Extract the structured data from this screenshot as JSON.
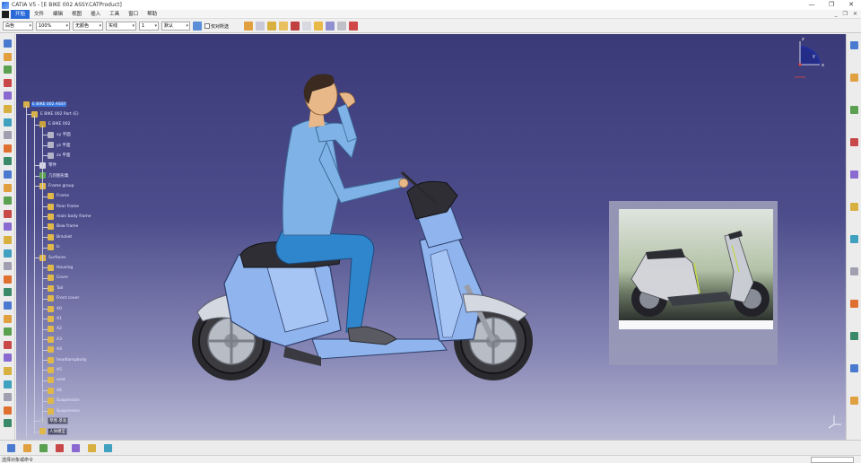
{
  "window": {
    "title": "CATIA V5 - [E BIKE 002 ASSY.CATProduct]",
    "buttons": [
      "—",
      "❐",
      "✕"
    ]
  },
  "menubar": {
    "items": [
      "开始",
      "文件",
      "编辑",
      "视图",
      "插入",
      "工具",
      "窗口",
      "帮助"
    ],
    "active_index": 0,
    "right_buttons": [
      "_",
      "❐",
      "✕"
    ]
  },
  "properties_toolbar": {
    "combos": [
      {
        "value": "白色"
      },
      {
        "value": "100%"
      },
      {
        "value": "无颜色"
      },
      {
        "value": "实线"
      },
      {
        "value": "1"
      },
      {
        "value": "默认"
      }
    ],
    "checkbox_label": "仅对所选"
  },
  "spec_tree": {
    "nodes": [
      {
        "label": "E BIKE 002 ASSY",
        "depth": 0,
        "selected": true,
        "icon_color": "#d7b24a"
      },
      {
        "label": "E BIKE 002 Part (E)",
        "depth": 1,
        "icon_color": "#d7b24a"
      },
      {
        "label": "E BIKE 002",
        "depth": 2,
        "icon_color": "#c9a33a"
      },
      {
        "label": "xy 平面",
        "depth": 3,
        "icon_color": "#b4b4c8"
      },
      {
        "label": "yz 平面",
        "depth": 3,
        "icon_color": "#b4b4c8"
      },
      {
        "label": "zx 平面",
        "depth": 3,
        "icon_color": "#b4b4c8"
      },
      {
        "label": "零件",
        "depth": 2,
        "icon_color": "#d4d4e4"
      },
      {
        "label": "几何图形集",
        "depth": 2,
        "icon_color": "#5fa64f"
      },
      {
        "label": "Frame group",
        "depth": 2,
        "icon_color": "#e0b84a"
      },
      {
        "label": "Frame",
        "depth": 3,
        "icon_color": "#e0b84a"
      },
      {
        "label": "Rear frame",
        "depth": 3,
        "icon_color": "#e0b84a"
      },
      {
        "label": "main body frame",
        "depth": 3,
        "icon_color": "#e0b84a"
      },
      {
        "label": "Bow frame",
        "depth": 3,
        "icon_color": "#e0b84a"
      },
      {
        "label": "Bracket",
        "depth": 3,
        "icon_color": "#e0b84a"
      },
      {
        "label": "Ic",
        "depth": 3,
        "icon_color": "#e0b84a"
      },
      {
        "label": "Surfaces",
        "depth": 2,
        "icon_color": "#e0b84a"
      },
      {
        "label": "Housing",
        "depth": 3,
        "icon_color": "#e0b84a"
      },
      {
        "label": "Cover",
        "depth": 3,
        "icon_color": "#e0b84a"
      },
      {
        "label": "Tail",
        "depth": 3,
        "icon_color": "#e0b84a"
      },
      {
        "label": "Front cover",
        "depth": 3,
        "icon_color": "#e0b84a"
      },
      {
        "label": "A0",
        "depth": 3,
        "icon_color": "#e0b84a"
      },
      {
        "label": "A1",
        "depth": 3,
        "icon_color": "#e0b84a"
      },
      {
        "label": "A2",
        "depth": 3,
        "icon_color": "#e0b84a"
      },
      {
        "label": "A3",
        "depth": 3,
        "icon_color": "#e0b84a"
      },
      {
        "label": "A4",
        "depth": 3,
        "icon_color": "#e0b84a"
      },
      {
        "label": "headlampbody",
        "depth": 3,
        "icon_color": "#e0b84a"
      },
      {
        "label": "A5",
        "depth": 3,
        "icon_color": "#e0b84a"
      },
      {
        "label": "seat",
        "depth": 3,
        "icon_color": "#e0b84a"
      },
      {
        "label": "A6",
        "depth": 3,
        "icon_color": "#e0b84a"
      },
      {
        "label": "Suspension",
        "depth": 3,
        "icon_color": "#e0b84a"
      },
      {
        "label": "Suspension",
        "depth": 3,
        "icon_color": "#e0b84a"
      },
      {
        "label": "草图.基准",
        "depth": 2,
        "boxed": true,
        "icon_color": "#b4b4c8"
      },
      {
        "label": "人体模型",
        "depth": 2,
        "boxed": true,
        "icon_color": "#e0b84a"
      }
    ]
  },
  "compass": {
    "x_label": "x",
    "y_label": "y",
    "z_label": "z"
  },
  "statusbar": {
    "text": "选择对象或命令"
  },
  "colors": {
    "viewport_top": "#3a3a78",
    "viewport_bottom": "#b8b8d4",
    "selection": "#3b78e0",
    "scooter_body": "#8fb4ee",
    "rider_shirt": "#7fb2e6",
    "rider_pants": "#2f86cc"
  },
  "icons": {
    "left_toolbar": [
      "sketch-icon",
      "point-icon",
      "line-icon",
      "plane-icon",
      "extrude-icon",
      "revolve-icon",
      "sweep-icon",
      "fill-icon",
      "join-icon",
      "trim-icon",
      "split-icon",
      "boundary-icon",
      "extract-icon",
      "fillet-icon",
      "translate-icon",
      "rotate-icon",
      "symmetry-icon",
      "scale-icon",
      "pattern-icon",
      "measure-icon",
      "analysis-icon",
      "render-icon",
      "material-icon",
      "scene-icon",
      "light-icon",
      "camera-icon",
      "turntable-icon",
      "snapshot-icon",
      "catalog-icon",
      "knowledge-icon"
    ],
    "right_toolbar": [
      "fly-icon",
      "fit-all-icon",
      "pan-icon",
      "rotate-view-icon",
      "zoom-in-icon",
      "zoom-out-icon",
      "normal-view-icon",
      "iso-view-icon",
      "shading-icon",
      "hide-show-icon",
      "swap-space-icon",
      "quick-view-icon"
    ],
    "bottom_toolbar": [
      "sketch-tool-icon",
      "constraint-icon",
      "grid-icon",
      "snap-icon",
      "measure-tool-icon",
      "table-icon",
      "compass-icon"
    ]
  }
}
